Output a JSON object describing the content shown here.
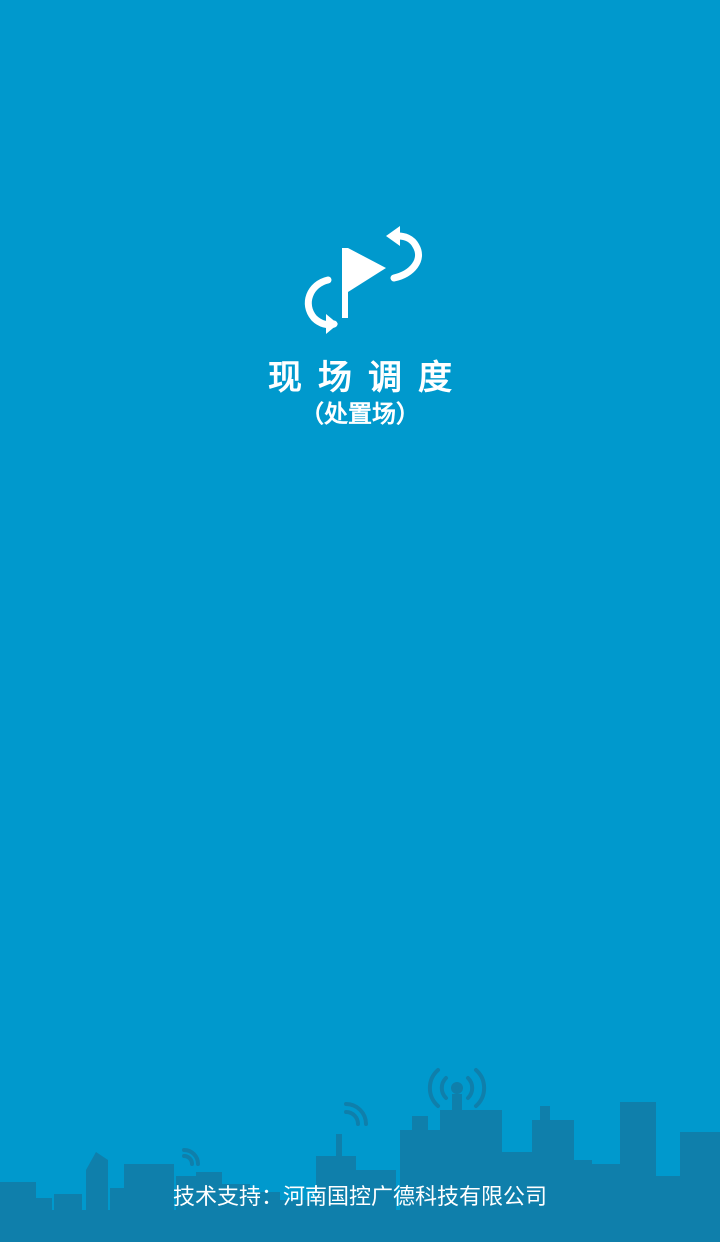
{
  "app": {
    "title": "现场调度",
    "subtitle": "（处置场）"
  },
  "footer": {
    "credit": "技术支持：河南国控广德科技有限公司"
  },
  "theme": {
    "background": "#0099cd",
    "skyline": "#0f7fab",
    "foreground": "#ffffff"
  },
  "icons": [
    "flag-cycle-logo-icon",
    "city-skyline",
    "signal-tower-icon"
  ]
}
